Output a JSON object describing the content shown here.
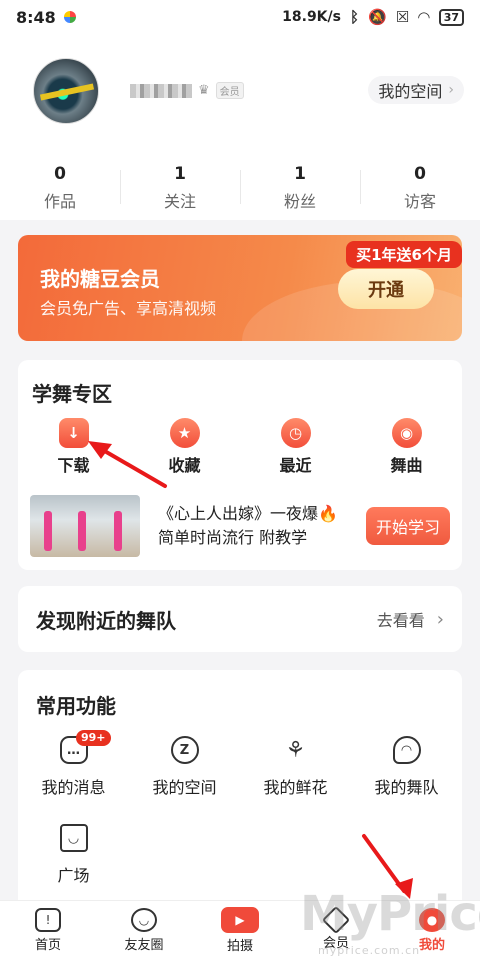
{
  "status_bar": {
    "time": "8:48",
    "net_speed": "18.9K/s",
    "battery": "37",
    "icons": [
      "bluetooth-icon",
      "mute-icon",
      "no-sim-icon",
      "wifi-icon"
    ]
  },
  "profile": {
    "vip_tag": "会员",
    "space_button": "我的空间",
    "stats": [
      {
        "num": "0",
        "label": "作品"
      },
      {
        "num": "1",
        "label": "关注"
      },
      {
        "num": "1",
        "label": "粉丝"
      },
      {
        "num": "0",
        "label": "访客"
      }
    ]
  },
  "vip_banner": {
    "title": "我的糖豆会员",
    "subtitle": "会员免广告、享高清视频",
    "promo": "买1年送6个月",
    "button": "开通"
  },
  "dance_zone": {
    "title": "学舞专区",
    "items": [
      {
        "label": "下载",
        "icon": "download-icon"
      },
      {
        "label": "收藏",
        "icon": "star-icon"
      },
      {
        "label": "最近",
        "icon": "clock-icon"
      },
      {
        "label": "舞曲",
        "icon": "music-disc-icon"
      }
    ],
    "promo": {
      "line1": "《心上人出嫁》一夜爆🔥",
      "line2": "简单时尚流行  附教学",
      "button": "开始学习"
    }
  },
  "nearby": {
    "title": "发现附近的舞队",
    "more": "去看看"
  },
  "functions": {
    "title": "常用功能",
    "items": [
      {
        "label": "我的消息",
        "icon": "message-icon",
        "badge": "99+"
      },
      {
        "label": "我的空间",
        "icon": "space-icon"
      },
      {
        "label": "我的鲜花",
        "icon": "flower-icon"
      },
      {
        "label": "我的舞队",
        "icon": "team-icon"
      },
      {
        "label": "广场",
        "icon": "bag-icon"
      }
    ]
  },
  "bottom_nav": [
    {
      "label": "首页",
      "icon": "home-icon"
    },
    {
      "label": "友友圈",
      "icon": "smile-icon"
    },
    {
      "label": "拍摄",
      "icon": "camera-icon"
    },
    {
      "label": "会员",
      "icon": "diamond-icon"
    },
    {
      "label": "我的",
      "icon": "user-icon",
      "active": true
    }
  ],
  "watermark": {
    "main": "MyPrice",
    "sub": "myprice.com.cn"
  },
  "colors": {
    "accent": "#f04a3a",
    "banner_start": "#f36a3a",
    "banner_end": "#f9b070"
  }
}
